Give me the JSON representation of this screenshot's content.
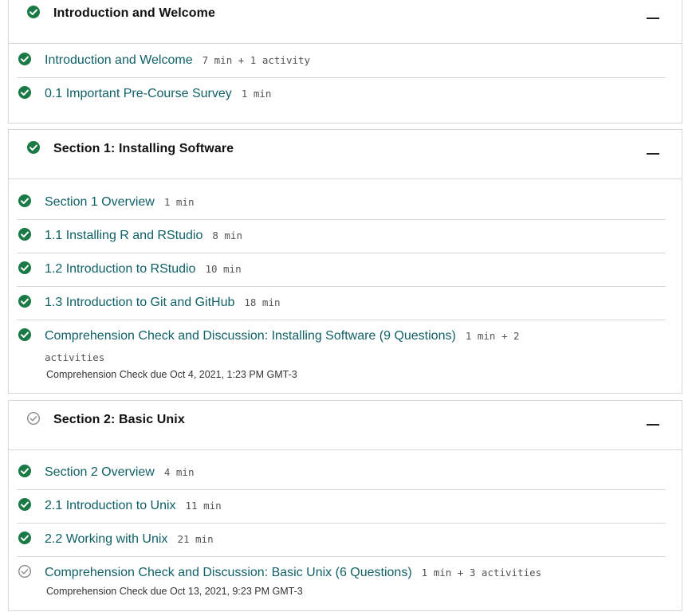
{
  "colors": {
    "complete": "#1a7a45",
    "incomplete": "#8a8a8a",
    "link": "#0f5f66"
  },
  "sections": [
    {
      "title": "Introduction and Welcome",
      "status": "complete",
      "collapse_icon": "minus-icon",
      "items": [
        {
          "label": "Introduction and Welcome",
          "meta": "7 min + 1 activity",
          "status": "complete"
        },
        {
          "label": "0.1 Important Pre-Course Survey",
          "meta": "1 min",
          "status": "complete"
        }
      ]
    },
    {
      "title": "Section 1: Installing Software",
      "status": "complete",
      "collapse_icon": "minus-icon",
      "items": [
        {
          "label": "Section 1 Overview",
          "meta": "1 min",
          "status": "complete"
        },
        {
          "label": "1.1 Installing R and RStudio",
          "meta": "8 min",
          "status": "complete"
        },
        {
          "label": "1.2 Introduction to RStudio",
          "meta": "10 min",
          "status": "complete"
        },
        {
          "label": "1.3 Introduction to Git and GitHub",
          "meta": "18 min",
          "status": "complete"
        },
        {
          "label": "Comprehension Check and Discussion: Installing Software (9 Questions)",
          "meta": "1 min + 2",
          "meta_wrap": "activities",
          "due": "Comprehension Check due Oct 4, 2021, 1:23 PM GMT-3",
          "status": "complete"
        }
      ]
    },
    {
      "title": "Section 2: Basic Unix",
      "status": "incomplete",
      "collapse_icon": "minus-icon",
      "items": [
        {
          "label": "Section 2 Overview",
          "meta": "4 min",
          "status": "complete"
        },
        {
          "label": "2.1 Introduction to Unix",
          "meta": "11 min",
          "status": "complete"
        },
        {
          "label": "2.2 Working with Unix",
          "meta": "21 min",
          "status": "complete"
        },
        {
          "label": "Comprehension Check and Discussion: Basic Unix (6 Questions)",
          "meta": "1 min + 3 activities",
          "due": "Comprehension Check due Oct 13, 2021, 9:23 PM GMT-3",
          "status": "incomplete"
        }
      ]
    }
  ]
}
